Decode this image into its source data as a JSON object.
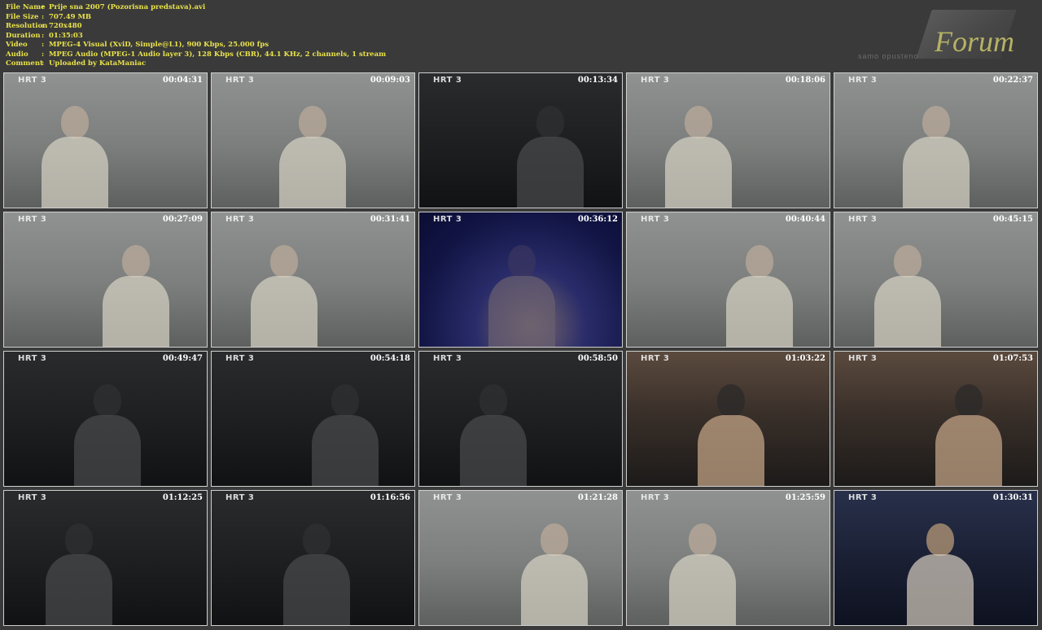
{
  "info": {
    "rows": [
      {
        "key": "File Name",
        "value": "Prije sna 2007 (Pozorisna predstava).avi"
      },
      {
        "key": "File Size",
        "value": "707.49 MB"
      },
      {
        "key": "Resolution",
        "value": "720x480"
      },
      {
        "key": "Duration",
        "value": "01:35:03"
      },
      {
        "key": "Video",
        "value": "MPEG-4 Visual (XviD, Simple@L1), 900 Kbps, 25.000 fps"
      },
      {
        "key": "Audio",
        "value": "MPEG Audio (MPEG-1 Audio layer 3), 128 Kbps (CBR), 44.1 KHz, 2 channels, 1 stream"
      },
      {
        "key": "Comment",
        "value": "Uploaded by KataManiac"
      }
    ]
  },
  "logo": {
    "brand": "Forum",
    "tagline": "samo opusteno"
  },
  "thumbnails": {
    "channel_logo": "HRT 3",
    "items": [
      {
        "time": "00:04:31",
        "scene": "light"
      },
      {
        "time": "00:09:03",
        "scene": "light"
      },
      {
        "time": "00:13:34",
        "scene": "dark"
      },
      {
        "time": "00:18:06",
        "scene": "light"
      },
      {
        "time": "00:22:37",
        "scene": "light"
      },
      {
        "time": "00:27:09",
        "scene": "light"
      },
      {
        "time": "00:31:41",
        "scene": "light"
      },
      {
        "time": "00:36:12",
        "scene": "blue"
      },
      {
        "time": "00:40:44",
        "scene": "light"
      },
      {
        "time": "00:45:15",
        "scene": "light"
      },
      {
        "time": "00:49:47",
        "scene": "dark"
      },
      {
        "time": "00:54:18",
        "scene": "dark"
      },
      {
        "time": "00:58:50",
        "scene": "dark"
      },
      {
        "time": "01:03:22",
        "scene": "warm"
      },
      {
        "time": "01:07:53",
        "scene": "warm"
      },
      {
        "time": "01:12:25",
        "scene": "dark"
      },
      {
        "time": "01:16:56",
        "scene": "dark"
      },
      {
        "time": "01:21:28",
        "scene": "light"
      },
      {
        "time": "01:25:59",
        "scene": "light"
      },
      {
        "time": "01:30:31",
        "scene": "navy"
      }
    ]
  },
  "colors": {
    "page_background": "#3a3a3a",
    "info_text": "#e9e24a",
    "thumb_border": "#cfcfcf",
    "timestamp": "#ffffff"
  }
}
